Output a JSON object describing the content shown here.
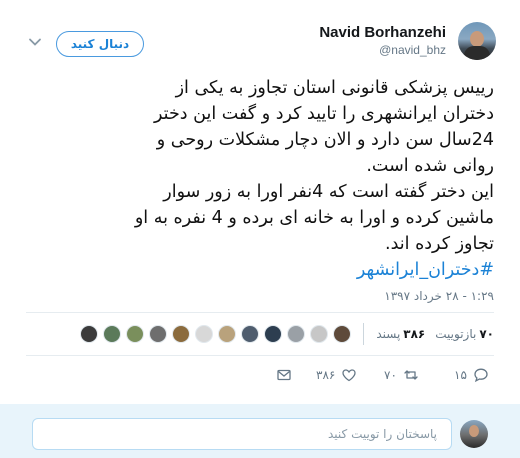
{
  "user": {
    "name": "Navid Borhanzehi",
    "handle": "@navid_bhz"
  },
  "follow_button": {
    "label": "دنبال کنید"
  },
  "tweet": {
    "lines": [
      "رییس پزشکی قانونی استان تجاوز به یکی از",
      "دختران ایرانشهری را تایید کرد و گفت این دختر",
      "24سال سن دارد و الان دچار مشکلات روحی و",
      "روانی شده است.",
      "این دختر گفته است که 4نفر اورا به زور سوار",
      "ماشین کرده و اورا به خانه ای برده و 4 نفره به او",
      "تجاوز کرده اند."
    ],
    "hashtag": "#دختران_ایرانشهر",
    "timestamp": "۱:۲۹ - ۲۸ خرداد ۱۳۹۷"
  },
  "stats": {
    "retweets_count": "۷۰",
    "retweets_label": "بازتوییت",
    "likes_count": "۳۸۶",
    "likes_label": "پسند",
    "liker_colors": [
      "#3b3b3b",
      "#5b7a5a",
      "#7a8f5c",
      "#6e6e6e",
      "#8b6b3d",
      "#d8d8d8",
      "#b9a27c",
      "#4f5d6e",
      "#2d3e50",
      "#9aa0a6",
      "#c7c7c7",
      "#5e4a3a"
    ]
  },
  "actions": {
    "replies": "۱۵",
    "retweets": "۷۰",
    "likes": "۳۸۶",
    "reply_icon": "reply-icon",
    "retweet_icon": "retweet-icon",
    "like_icon": "heart-icon",
    "dm_icon": "envelope-icon"
  },
  "reply_box": {
    "placeholder": "پاسختان را توییت کنید"
  },
  "colors": {
    "accent": "#1b82d6",
    "muted": "#657786",
    "reply_bg": "#e8f4fb"
  }
}
